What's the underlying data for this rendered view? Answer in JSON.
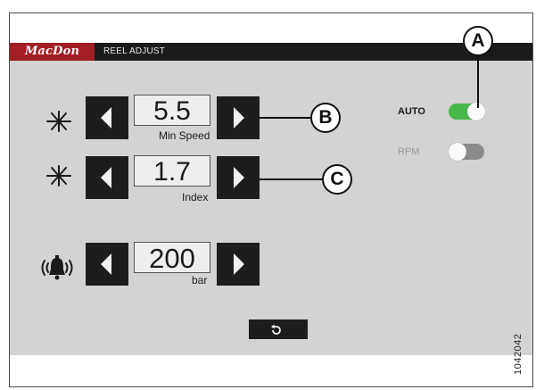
{
  "header": {
    "logo": "MacDon",
    "title": "REEL ADJUST"
  },
  "rows": [
    {
      "icon": "reel-speed-icon",
      "value": "5.5",
      "sublabel": "Min Speed"
    },
    {
      "icon": "reel-index-icon",
      "value": "1.7",
      "sublabel": "Index"
    },
    {
      "icon": "alarm-bell-icon",
      "value": "200",
      "sublabel": "bar"
    }
  ],
  "toggles": {
    "auto": {
      "label": "AUTO",
      "state": "on",
      "color": "#48b84a"
    },
    "rpm": {
      "label": "RPM",
      "state": "off",
      "color": "#8a8a8a"
    }
  },
  "back_button": {
    "icon": "back-arrow-icon"
  },
  "callouts": {
    "a": "A",
    "b": "B",
    "c": "C"
  },
  "figure_id": "1042042"
}
